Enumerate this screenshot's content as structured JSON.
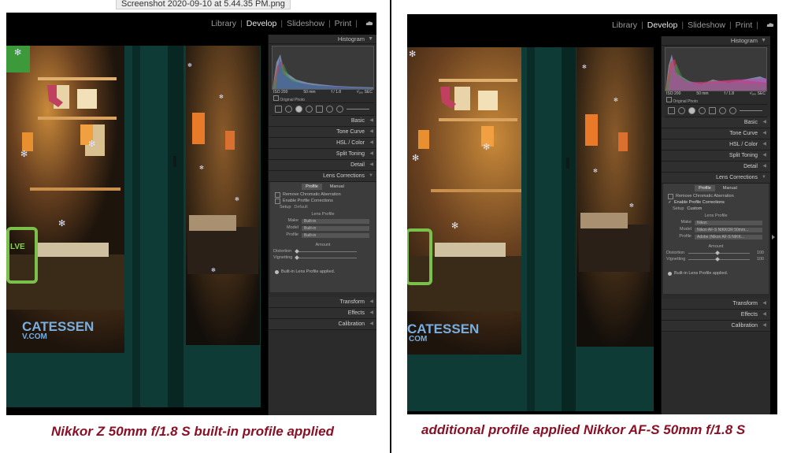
{
  "tooltip": "Screenshot 2020-09-10 at 5.44.35 PM.png",
  "modules": [
    "Library",
    "Develop",
    "Slideshow",
    "Print"
  ],
  "active_module": "Develop",
  "panel": {
    "histogram_label": "Histogram",
    "iso": "ISO 200",
    "focal": "50 mm",
    "aperture": "f / 1.8",
    "shutter": "¹⁄₁₆₀ SEC",
    "original_photo": "Original Photo",
    "sections": [
      "Basic",
      "Tone Curve",
      "HSL / Color",
      "Split Toning",
      "Detail",
      "Lens Corrections"
    ],
    "lens_tabs": [
      "Profile",
      "Manual"
    ],
    "remove_ca": "Remove Chromatic Aberration",
    "enable_profile": "Enable Profile Corrections",
    "setup_label": "Setup",
    "lens_profile": "Lens Profile",
    "make_label": "Make",
    "model_label": "Model",
    "profile_label": "Profile",
    "amount_label": "Amount",
    "distortion_label": "Distortion",
    "vignetting_label": "Vignetting",
    "note": "Built-in Lens Profile applied.",
    "bottom_sections": [
      "Transform",
      "Effects",
      "Calibration"
    ]
  },
  "left": {
    "setup_value": "Default",
    "make_value": "Built-in",
    "model_value": "Built-in",
    "profile_value": "Built-in",
    "distortion_value": "",
    "vignetting_value": "",
    "caption": "Nikkor Z 50mm f/1.8 S built-in profile applied"
  },
  "right": {
    "setup_value": "Custom",
    "make_value": "Nikon",
    "model_value": "Nikon AF-S NIKKOR 50mm...",
    "profile_value": "Adobe (Nikon AF-S NIKK...",
    "distortion_value": "100",
    "vignetting_value": "100",
    "caption": "additional profile applied Nikkor AF-S 50mm f/1.8 S"
  },
  "photo_text": {
    "deli": "CATESSEN",
    "web": "V.COM",
    "right_web": "COM",
    "sign": "LVE"
  },
  "colors": {
    "caption": "#8a1026",
    "frame_green": "#0e3b36",
    "panel_bg": "#2b2b2b"
  }
}
